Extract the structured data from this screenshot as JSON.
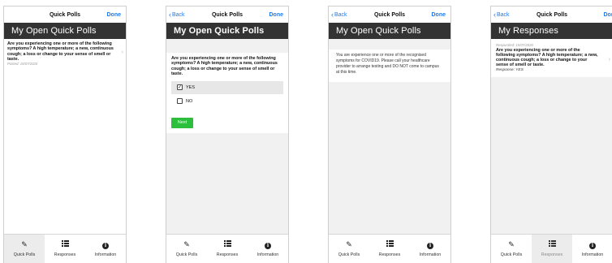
{
  "screens": [
    {
      "nav": {
        "title": "Quick Polls",
        "done": "Done"
      },
      "header": "My Open Quick Polls",
      "poll": {
        "question": "Are you experiencing one or more of the following symptoms? A high temperature; a new, continuous cough; a loss or change to your sense of smell or taste.",
        "posted": "Posted: 15/07/2020"
      }
    },
    {
      "nav": {
        "back": "Back",
        "title": "Quick Polls",
        "done": "Done"
      },
      "header": "My Open Quick Polls",
      "question": "Are you experiencing one or more of the following symptoms? A high temperature; a new, continuous cough; a loss or change to your sense of smell or taste.",
      "options": [
        {
          "label": "YES",
          "checked": true
        },
        {
          "label": "NO",
          "checked": false
        }
      ],
      "next": "Next"
    },
    {
      "nav": {
        "back": "Back",
        "title": "Quick Polls",
        "done": "Done"
      },
      "header": "My Open Quick Polls",
      "message": "You are experience one or more of the recognised symptoms for COVID19. Please call your healthcare provider to arrange testing and DO NOT come to campus at this time."
    },
    {
      "nav": {
        "back": "Back",
        "title": "Quick Polls",
        "done": "Done"
      },
      "header": "My Responses",
      "response": {
        "responded": "Responded: 15/07/2020",
        "question": "Are you experiencing one or more of the following symptoms? A high temperature; a new, continuous cough; a loss or change to your sense of smell or taste.",
        "answer": "Response: YES"
      }
    }
  ],
  "tabs": [
    {
      "label": "Quick Polls",
      "icon": "edit-icon"
    },
    {
      "label": "Responses",
      "icon": "list-icon"
    },
    {
      "label": "Information",
      "icon": "info-icon"
    }
  ],
  "colors": {
    "accent": "#1a7cf0",
    "header_bg": "#333333",
    "next_button": "#2bbf3d"
  }
}
